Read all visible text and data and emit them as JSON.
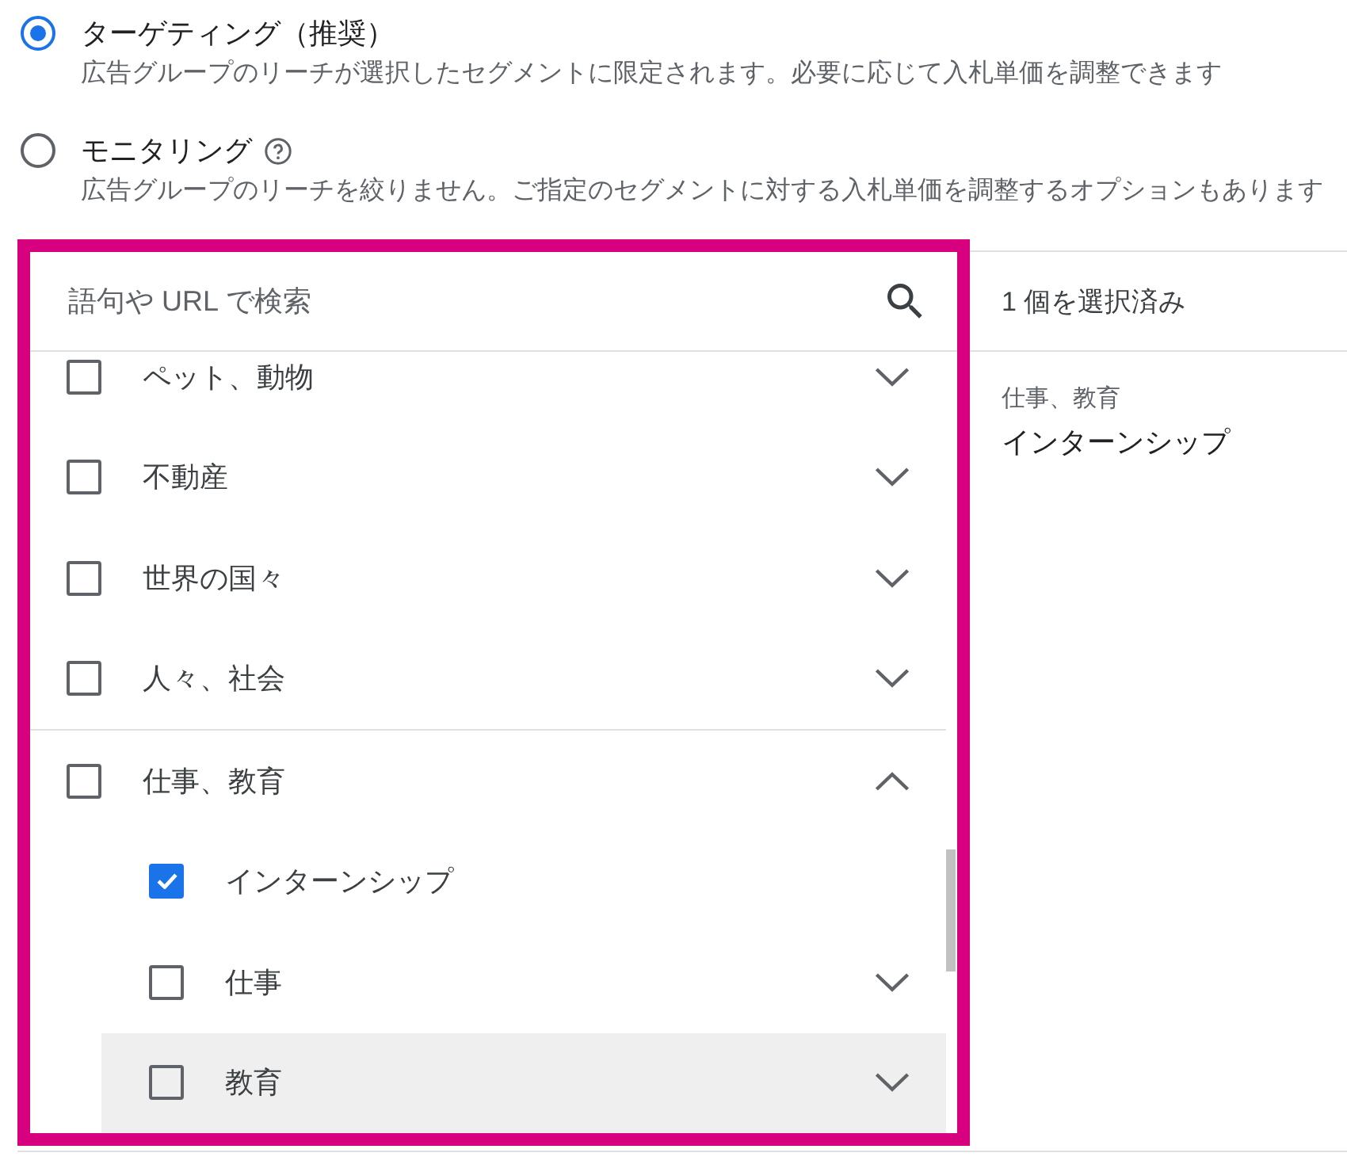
{
  "options": [
    {
      "label": "ターゲティング（推奨）",
      "description": "広告グループのリーチが選択したセグメントに限定されます。必要に応じて入札単価を調整できます",
      "selected": true,
      "help": false
    },
    {
      "label": "モニタリング",
      "description": "広告グループのリーチを絞りません。ご指定のセグメントに対する入札単価を調整するオプションもあります",
      "selected": false,
      "help": true
    }
  ],
  "search": {
    "placeholder": "語句や URL で検索"
  },
  "categories": [
    {
      "label": "ペット、動物",
      "kind": "category",
      "checked": false,
      "expanded": false,
      "hovered": false
    },
    {
      "label": "不動産",
      "kind": "category",
      "checked": false,
      "expanded": false,
      "hovered": false
    },
    {
      "label": "世界の国々",
      "kind": "category",
      "checked": false,
      "expanded": false,
      "hovered": false
    },
    {
      "label": "人々、社会",
      "kind": "category",
      "checked": false,
      "expanded": false,
      "hovered": false
    },
    {
      "label": "仕事、教育",
      "kind": "category",
      "checked": false,
      "expanded": true,
      "hovered": false,
      "children": [
        {
          "label": "インターンシップ",
          "kind": "leaf",
          "checked": true,
          "hovered": false
        },
        {
          "label": "仕事",
          "kind": "category",
          "checked": false,
          "expanded": false,
          "hovered": false
        },
        {
          "label": "教育",
          "kind": "category",
          "checked": false,
          "expanded": false,
          "hovered": true
        }
      ]
    }
  ],
  "selection": {
    "count": "1 個を選択済み",
    "items": [
      {
        "path": "仕事、教育",
        "label": "インターンシップ"
      }
    ]
  }
}
